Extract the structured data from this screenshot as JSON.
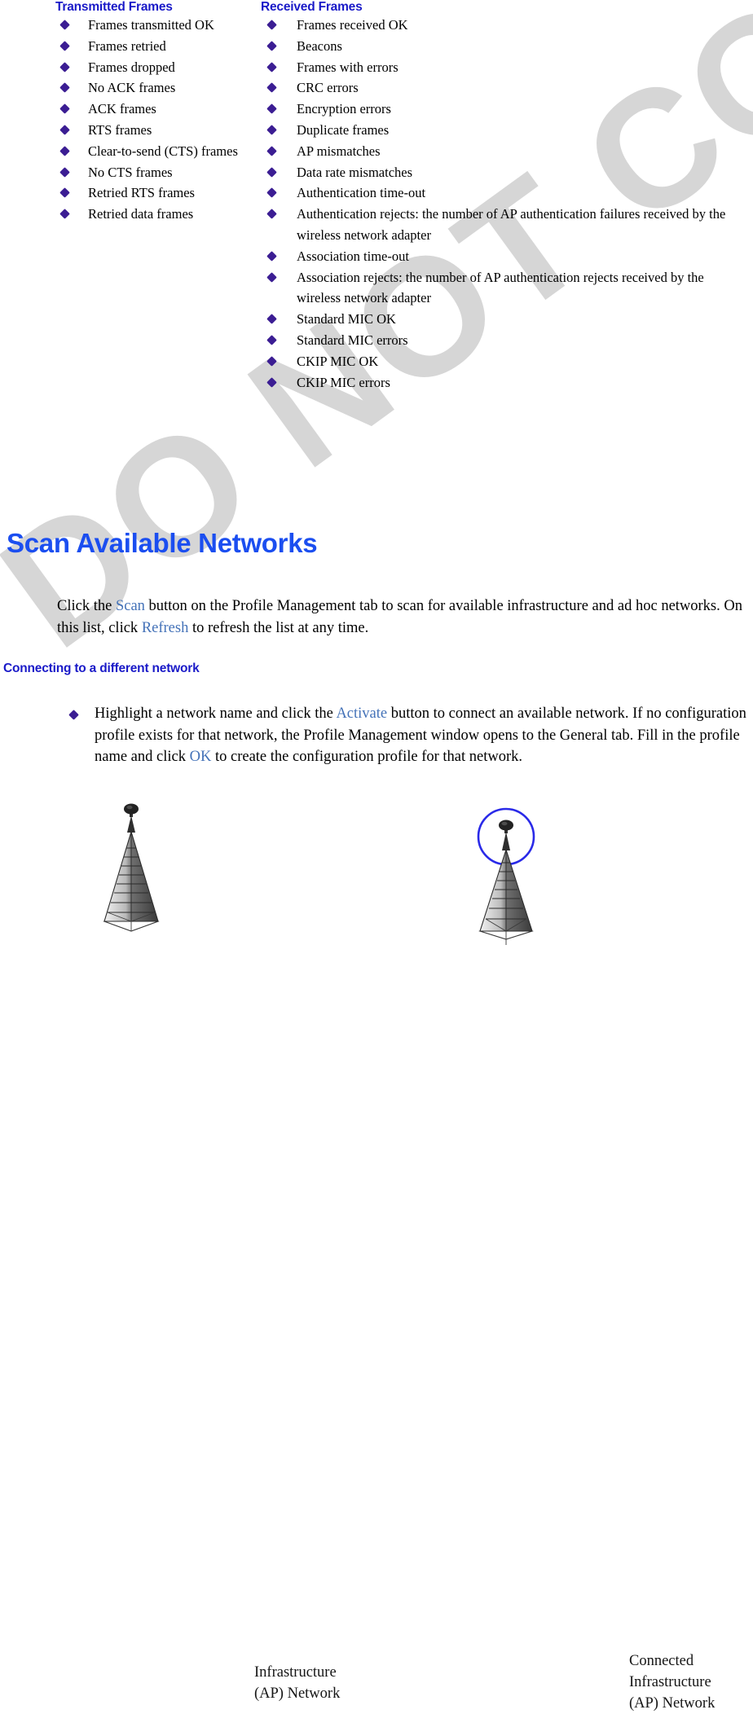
{
  "watermark": {
    "text": "DO NOT COPY",
    "color": "#d6d6d6"
  },
  "colors": {
    "heading_blue": "#1b4ef0",
    "subheading_blue": "#1a1ac8",
    "link_blue": "#4472b8",
    "bullet_diamond": "#3b1d93",
    "ring_blue": "#2a2ae8"
  },
  "columns": {
    "left": {
      "heading": "Transmitted Frames",
      "items": [
        "Frames transmitted OK",
        "Frames retried",
        "Frames dropped",
        "No ACK frames",
        "ACK frames",
        "RTS frames",
        "Clear-to-send (CTS) frames",
        "No CTS frames",
        "Retried RTS frames",
        "Retried data frames"
      ]
    },
    "right": {
      "heading": "Received Frames",
      "items": [
        "Frames received OK",
        "Beacons",
        "Frames with errors",
        "CRC errors",
        "Encryption errors",
        "Duplicate frames",
        "AP mismatches",
        "Data rate mismatches",
        "Authentication time-out",
        "Authentication rejects: the number of AP authentication failures received by the wireless network adapter",
        "Association time-out",
        "Association rejects:  the number of AP authentication rejects received by the wireless network adapter",
        "Standard MIC OK",
        "Standard MIC errors",
        "CKIP MIC OK",
        "CKIP MIC errors"
      ]
    }
  },
  "section": {
    "title": "Scan Available Networks",
    "intro": {
      "part1": "Click the ",
      "link1": "Scan",
      "part2": " button on the Profile Management tab to scan for available infrastructure and ad hoc networks. On this list, click ",
      "link2": "Refresh",
      "part3": " to refresh the list at any time."
    },
    "subheading": "Connecting to a different network",
    "bullet_paragraph": {
      "part1": "Highlight a network name and click the ",
      "link1": "Activate",
      "part2": " button to connect an available network. If no configuration profile exists for that network, the Profile Management window opens to the General tab.  Fill in the profile name and click ",
      "link2": "OK",
      "part3": " to create the configuration profile for that network."
    }
  },
  "figures": [
    {
      "icon": "antenna-tower-icon",
      "connected": false,
      "caption_line1": "Infrastructure",
      "caption_line2": "(AP) Network",
      "caption_line3": ""
    },
    {
      "icon": "antenna-tower-connected-icon",
      "connected": true,
      "caption_line1": "Connected",
      "caption_line2": "Infrastructure",
      "caption_line3": "(AP) Network"
    }
  ]
}
